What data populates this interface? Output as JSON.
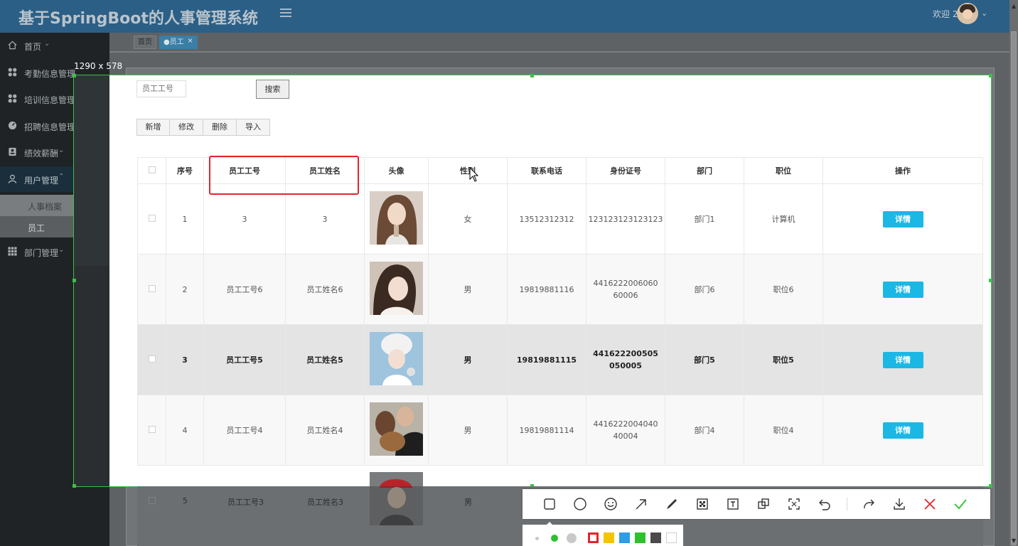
{
  "header": {
    "app_title": "基于SpringBoot的人事管理系统",
    "welcome": "欢迎 2"
  },
  "sidebar": {
    "items": [
      {
        "label": "首页"
      },
      {
        "label": "考勤信息管理"
      },
      {
        "label": "培训信息管理"
      },
      {
        "label": "招聘信息管理"
      },
      {
        "label": "绩效薪酬"
      },
      {
        "label": "用户管理"
      },
      {
        "label": "部门管理"
      }
    ],
    "sub_items": [
      {
        "label": "人事档案"
      },
      {
        "label": "员工"
      }
    ]
  },
  "tabs": [
    {
      "label": "首页"
    },
    {
      "label": "●员工",
      "close": "×"
    }
  ],
  "selection": {
    "size_label": "1290 x 578"
  },
  "search": {
    "placeholder": "员工工号",
    "button": "搜索"
  },
  "actions": [
    "新增",
    "修改",
    "删除",
    "导入"
  ],
  "table": {
    "columns": [
      "序号",
      "员工工号",
      "员工姓名",
      "头像",
      "性别",
      "联系电话",
      "身份证号",
      "部门",
      "职位",
      "操作"
    ],
    "detail_label": "详情",
    "rows": [
      {
        "no": "1",
        "emp_no": "3",
        "name": "3",
        "gender": "女",
        "phone": "13512312312",
        "id_card": "123123123123123",
        "dept": "部门1",
        "position": "计算机"
      },
      {
        "no": "2",
        "emp_no": "员工工号6",
        "name": "员工姓名6",
        "gender": "男",
        "phone": "19819881116",
        "id_card": "441622200606060006",
        "dept": "部门6",
        "position": "职位6"
      },
      {
        "no": "3",
        "emp_no": "员工工号5",
        "name": "员工姓名5",
        "gender": "男",
        "phone": "19819881115",
        "id_card": "441622200505050005",
        "dept": "部门5",
        "position": "职位5"
      },
      {
        "no": "4",
        "emp_no": "员工工号4",
        "name": "员工姓名4",
        "gender": "男",
        "phone": "19819881114",
        "id_card": "441622200404040004",
        "dept": "部门4",
        "position": "职位4"
      },
      {
        "no": "5",
        "emp_no": "员工工号3",
        "name": "员工姓名3",
        "gender": "男",
        "phone": "",
        "id_card": "",
        "dept": "",
        "position": ""
      }
    ]
  },
  "toolbar": {
    "tools": [
      "rectangle",
      "ellipse",
      "emoji",
      "arrow",
      "pen",
      "mosaic",
      "text",
      "copy",
      "ocr",
      "undo",
      "redo",
      "save",
      "cancel",
      "confirm"
    ],
    "colors": [
      "#e0262e",
      "#f5c400",
      "#2e9ce6",
      "#2ec12e",
      "#4a4a4a",
      "#ffffff"
    ]
  }
}
